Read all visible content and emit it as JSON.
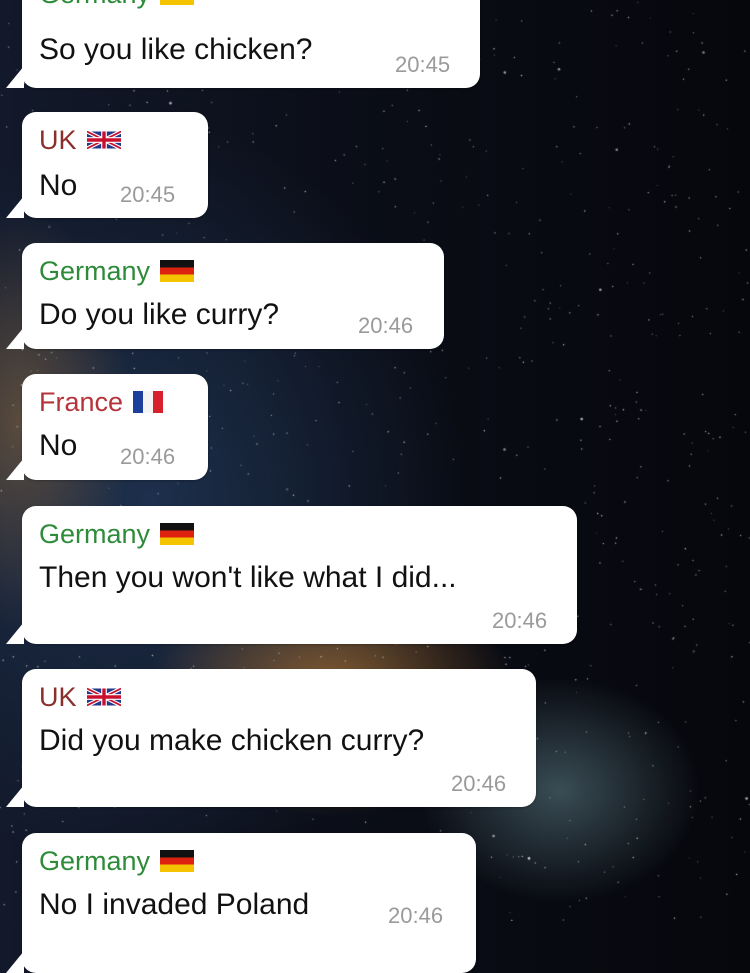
{
  "chat": {
    "messages": [
      {
        "sender": "Germany",
        "sender_color": "#2e8b3a",
        "flag": "germany-flag-icon",
        "text": "So you like chicken?",
        "time": "20:45"
      },
      {
        "sender": "UK",
        "sender_color": "#8a2f2a",
        "flag": "uk-flag-icon",
        "text": "No",
        "time": "20:45"
      },
      {
        "sender": "Germany",
        "sender_color": "#2e8b3a",
        "flag": "germany-flag-icon",
        "text": "Do you like curry?",
        "time": "20:46"
      },
      {
        "sender": "France",
        "sender_color": "#b5343a",
        "flag": "france-flag-icon",
        "text": "No",
        "time": "20:46"
      },
      {
        "sender": "Germany",
        "sender_color": "#2e8b3a",
        "flag": "germany-flag-icon",
        "text": "Then you won't like what I did...",
        "time": "20:46"
      },
      {
        "sender": "UK",
        "sender_color": "#8a2f2a",
        "flag": "uk-flag-icon",
        "text": "Did you make chicken curry?",
        "time": "20:46"
      },
      {
        "sender": "Germany",
        "sender_color": "#2e8b3a",
        "flag": "germany-flag-icon",
        "text": "No I invaded Poland",
        "time": "20:46"
      }
    ]
  }
}
